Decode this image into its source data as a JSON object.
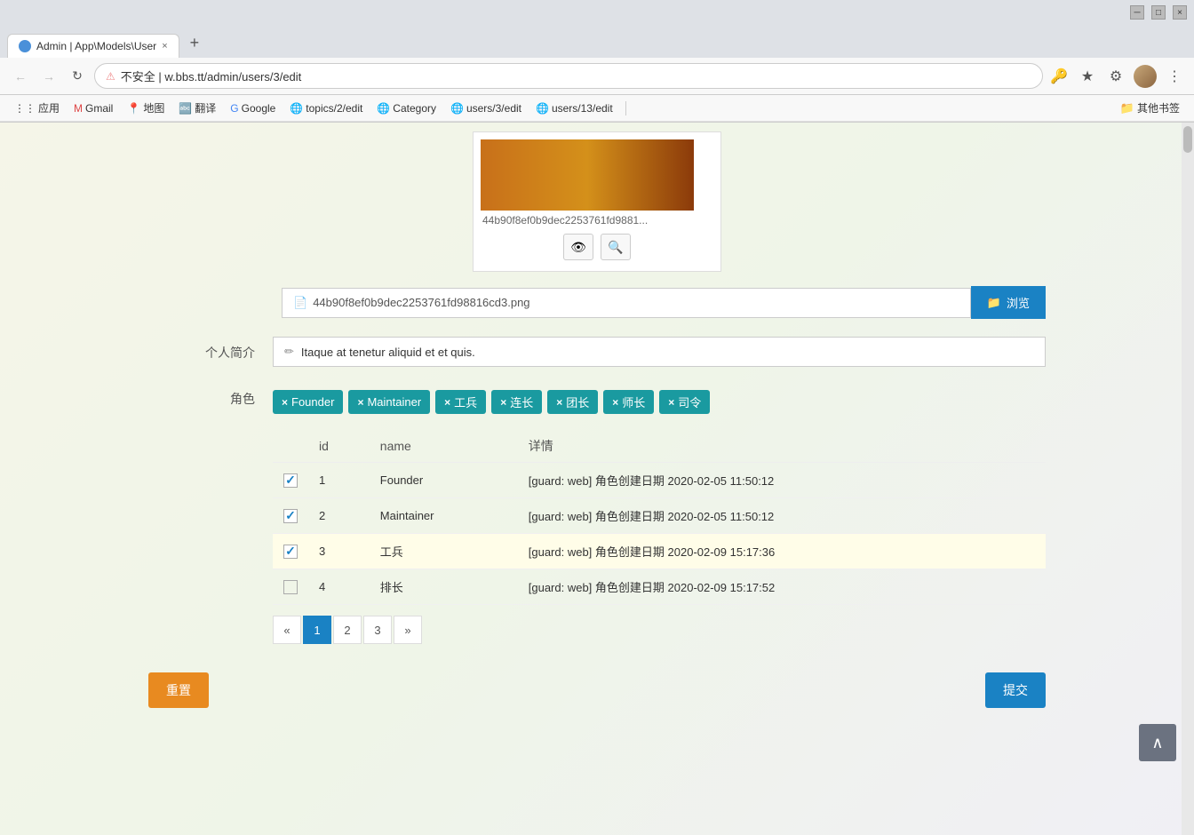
{
  "browser": {
    "tab_title": "Admin | App\\Models\\User",
    "tab_icon": "globe",
    "close_btn": "×",
    "new_tab_btn": "+",
    "nav": {
      "back": "←",
      "forward": "→",
      "reload": "↺"
    },
    "address": {
      "lock_icon": "⚠",
      "url": "w.bbs.tt/admin/users/3/edit"
    },
    "toolbar": {
      "key_icon": "🔑",
      "star_icon": "★",
      "extensions_icon": "⚙",
      "menu_icon": "⋮"
    },
    "bookmarks": [
      {
        "label": "应用",
        "icon": "⋮⋮"
      },
      {
        "label": "Gmail",
        "icon": "M"
      },
      {
        "label": "地图",
        "icon": "📍"
      },
      {
        "label": "翻译",
        "icon": "🔤"
      },
      {
        "label": "Google",
        "icon": "G"
      },
      {
        "label": "topics/2/edit",
        "icon": "🌐"
      },
      {
        "label": "Category",
        "icon": "🌐"
      },
      {
        "label": "users/3/edit",
        "icon": "🌐"
      },
      {
        "label": "users/13/edit",
        "icon": "🌐"
      }
    ],
    "other_bookmarks": "其他书签"
  },
  "form": {
    "image": {
      "filename_short": "44b90f8ef0b9dec2253761fd9881...",
      "filename_full": "44b90f8ef0b9dec2253761fd98816cd3.png",
      "preview_icon1": "👁",
      "preview_icon2": "🔍"
    },
    "bio_label": "个人简介",
    "bio_icon": "✏",
    "bio_value": "Itaque at tenetur aliquid et et quis.",
    "role_label": "角色",
    "roles_selected": [
      {
        "id": "founder",
        "label": "Founder"
      },
      {
        "id": "maintainer",
        "label": "Maintainer"
      },
      {
        "id": "gongbing",
        "label": "工兵"
      },
      {
        "id": "lianchang",
        "label": "连长"
      },
      {
        "id": "tuanzhang",
        "label": "团长"
      },
      {
        "id": "shizhang",
        "label": "师长"
      },
      {
        "id": "siling",
        "label": "司令"
      }
    ],
    "table": {
      "headers": [
        "id",
        "name",
        "详情"
      ],
      "rows": [
        {
          "checked": true,
          "id": "1",
          "name": "Founder",
          "detail": "[guard: web] 角色创建日期 2020-02-05 11:50:12",
          "highlighted": false
        },
        {
          "checked": true,
          "id": "2",
          "name": "Maintainer",
          "detail": "[guard: web] 角色创建日期 2020-02-05 11:50:12",
          "highlighted": false
        },
        {
          "checked": true,
          "id": "3",
          "name": "工兵",
          "detail": "[guard: web] 角色创建日期 2020-02-09 15:17:36",
          "highlighted": true
        },
        {
          "checked": false,
          "id": "4",
          "name": "排长",
          "detail": "[guard: web] 角色创建日期 2020-02-09 15:17:52",
          "highlighted": false
        }
      ]
    },
    "pagination": {
      "prev": "«",
      "pages": [
        "1",
        "2",
        "3"
      ],
      "next": "»",
      "active_page": "1"
    },
    "reset_label": "重置",
    "submit_label": "提交",
    "browse_label": "浏览",
    "browse_icon": "📁"
  },
  "scroll_top_icon": "∧"
}
